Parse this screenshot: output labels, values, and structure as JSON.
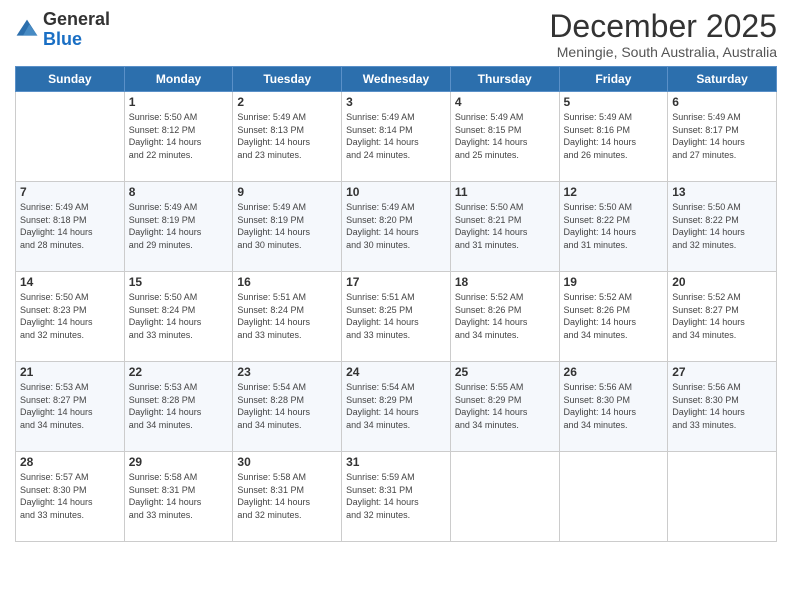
{
  "header": {
    "logo_general": "General",
    "logo_blue": "Blue",
    "month_title": "December 2025",
    "location": "Meningie, South Australia, Australia"
  },
  "days_of_week": [
    "Sunday",
    "Monday",
    "Tuesday",
    "Wednesday",
    "Thursday",
    "Friday",
    "Saturday"
  ],
  "weeks": [
    [
      {
        "day": "",
        "sunrise": "",
        "sunset": "",
        "daylight": ""
      },
      {
        "day": "1",
        "sunrise": "Sunrise: 5:50 AM",
        "sunset": "Sunset: 8:12 PM",
        "daylight": "Daylight: 14 hours and 22 minutes."
      },
      {
        "day": "2",
        "sunrise": "Sunrise: 5:49 AM",
        "sunset": "Sunset: 8:13 PM",
        "daylight": "Daylight: 14 hours and 23 minutes."
      },
      {
        "day": "3",
        "sunrise": "Sunrise: 5:49 AM",
        "sunset": "Sunset: 8:14 PM",
        "daylight": "Daylight: 14 hours and 24 minutes."
      },
      {
        "day": "4",
        "sunrise": "Sunrise: 5:49 AM",
        "sunset": "Sunset: 8:15 PM",
        "daylight": "Daylight: 14 hours and 25 minutes."
      },
      {
        "day": "5",
        "sunrise": "Sunrise: 5:49 AM",
        "sunset": "Sunset: 8:16 PM",
        "daylight": "Daylight: 14 hours and 26 minutes."
      },
      {
        "day": "6",
        "sunrise": "Sunrise: 5:49 AM",
        "sunset": "Sunset: 8:17 PM",
        "daylight": "Daylight: 14 hours and 27 minutes."
      }
    ],
    [
      {
        "day": "7",
        "sunrise": "Sunrise: 5:49 AM",
        "sunset": "Sunset: 8:18 PM",
        "daylight": "Daylight: 14 hours and 28 minutes."
      },
      {
        "day": "8",
        "sunrise": "Sunrise: 5:49 AM",
        "sunset": "Sunset: 8:19 PM",
        "daylight": "Daylight: 14 hours and 29 minutes."
      },
      {
        "day": "9",
        "sunrise": "Sunrise: 5:49 AM",
        "sunset": "Sunset: 8:19 PM",
        "daylight": "Daylight: 14 hours and 30 minutes."
      },
      {
        "day": "10",
        "sunrise": "Sunrise: 5:49 AM",
        "sunset": "Sunset: 8:20 PM",
        "daylight": "Daylight: 14 hours and 30 minutes."
      },
      {
        "day": "11",
        "sunrise": "Sunrise: 5:50 AM",
        "sunset": "Sunset: 8:21 PM",
        "daylight": "Daylight: 14 hours and 31 minutes."
      },
      {
        "day": "12",
        "sunrise": "Sunrise: 5:50 AM",
        "sunset": "Sunset: 8:22 PM",
        "daylight": "Daylight: 14 hours and 31 minutes."
      },
      {
        "day": "13",
        "sunrise": "Sunrise: 5:50 AM",
        "sunset": "Sunset: 8:22 PM",
        "daylight": "Daylight: 14 hours and 32 minutes."
      }
    ],
    [
      {
        "day": "14",
        "sunrise": "Sunrise: 5:50 AM",
        "sunset": "Sunset: 8:23 PM",
        "daylight": "Daylight: 14 hours and 32 minutes."
      },
      {
        "day": "15",
        "sunrise": "Sunrise: 5:50 AM",
        "sunset": "Sunset: 8:24 PM",
        "daylight": "Daylight: 14 hours and 33 minutes."
      },
      {
        "day": "16",
        "sunrise": "Sunrise: 5:51 AM",
        "sunset": "Sunset: 8:24 PM",
        "daylight": "Daylight: 14 hours and 33 minutes."
      },
      {
        "day": "17",
        "sunrise": "Sunrise: 5:51 AM",
        "sunset": "Sunset: 8:25 PM",
        "daylight": "Daylight: 14 hours and 33 minutes."
      },
      {
        "day": "18",
        "sunrise": "Sunrise: 5:52 AM",
        "sunset": "Sunset: 8:26 PM",
        "daylight": "Daylight: 14 hours and 34 minutes."
      },
      {
        "day": "19",
        "sunrise": "Sunrise: 5:52 AM",
        "sunset": "Sunset: 8:26 PM",
        "daylight": "Daylight: 14 hours and 34 minutes."
      },
      {
        "day": "20",
        "sunrise": "Sunrise: 5:52 AM",
        "sunset": "Sunset: 8:27 PM",
        "daylight": "Daylight: 14 hours and 34 minutes."
      }
    ],
    [
      {
        "day": "21",
        "sunrise": "Sunrise: 5:53 AM",
        "sunset": "Sunset: 8:27 PM",
        "daylight": "Daylight: 14 hours and 34 minutes."
      },
      {
        "day": "22",
        "sunrise": "Sunrise: 5:53 AM",
        "sunset": "Sunset: 8:28 PM",
        "daylight": "Daylight: 14 hours and 34 minutes."
      },
      {
        "day": "23",
        "sunrise": "Sunrise: 5:54 AM",
        "sunset": "Sunset: 8:28 PM",
        "daylight": "Daylight: 14 hours and 34 minutes."
      },
      {
        "day": "24",
        "sunrise": "Sunrise: 5:54 AM",
        "sunset": "Sunset: 8:29 PM",
        "daylight": "Daylight: 14 hours and 34 minutes."
      },
      {
        "day": "25",
        "sunrise": "Sunrise: 5:55 AM",
        "sunset": "Sunset: 8:29 PM",
        "daylight": "Daylight: 14 hours and 34 minutes."
      },
      {
        "day": "26",
        "sunrise": "Sunrise: 5:56 AM",
        "sunset": "Sunset: 8:30 PM",
        "daylight": "Daylight: 14 hours and 34 minutes."
      },
      {
        "day": "27",
        "sunrise": "Sunrise: 5:56 AM",
        "sunset": "Sunset: 8:30 PM",
        "daylight": "Daylight: 14 hours and 33 minutes."
      }
    ],
    [
      {
        "day": "28",
        "sunrise": "Sunrise: 5:57 AM",
        "sunset": "Sunset: 8:30 PM",
        "daylight": "Daylight: 14 hours and 33 minutes."
      },
      {
        "day": "29",
        "sunrise": "Sunrise: 5:58 AM",
        "sunset": "Sunset: 8:31 PM",
        "daylight": "Daylight: 14 hours and 33 minutes."
      },
      {
        "day": "30",
        "sunrise": "Sunrise: 5:58 AM",
        "sunset": "Sunset: 8:31 PM",
        "daylight": "Daylight: 14 hours and 32 minutes."
      },
      {
        "day": "31",
        "sunrise": "Sunrise: 5:59 AM",
        "sunset": "Sunset: 8:31 PM",
        "daylight": "Daylight: 14 hours and 32 minutes."
      },
      {
        "day": "",
        "sunrise": "",
        "sunset": "",
        "daylight": ""
      },
      {
        "day": "",
        "sunrise": "",
        "sunset": "",
        "daylight": ""
      },
      {
        "day": "",
        "sunrise": "",
        "sunset": "",
        "daylight": ""
      }
    ]
  ]
}
